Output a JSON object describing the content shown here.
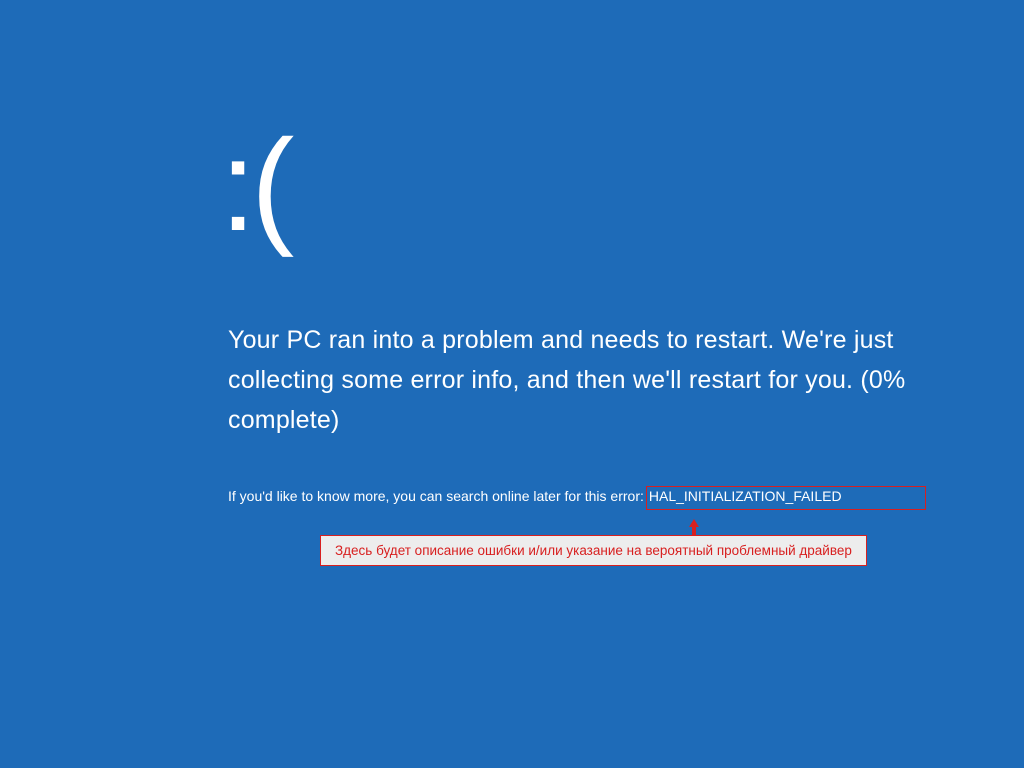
{
  "bsod": {
    "sad_face": ":(",
    "main_message": "Your PC ran into a problem and needs to restart. We're just collecting some error info, and then we'll restart for you. (0% complete)",
    "sub_message_prefix": "If you'd like to know more, you can search online later for this error:",
    "error_code": " HAL_INITIALIZATION_FAILED"
  },
  "annotation": {
    "text": "Здесь будет описание ошибки и/или указание на вероятный проблемный драйвер"
  },
  "colors": {
    "background": "#1e6bb8",
    "text": "#ffffff",
    "highlight_border": "#d82020",
    "annotation_bg": "#ededed"
  }
}
